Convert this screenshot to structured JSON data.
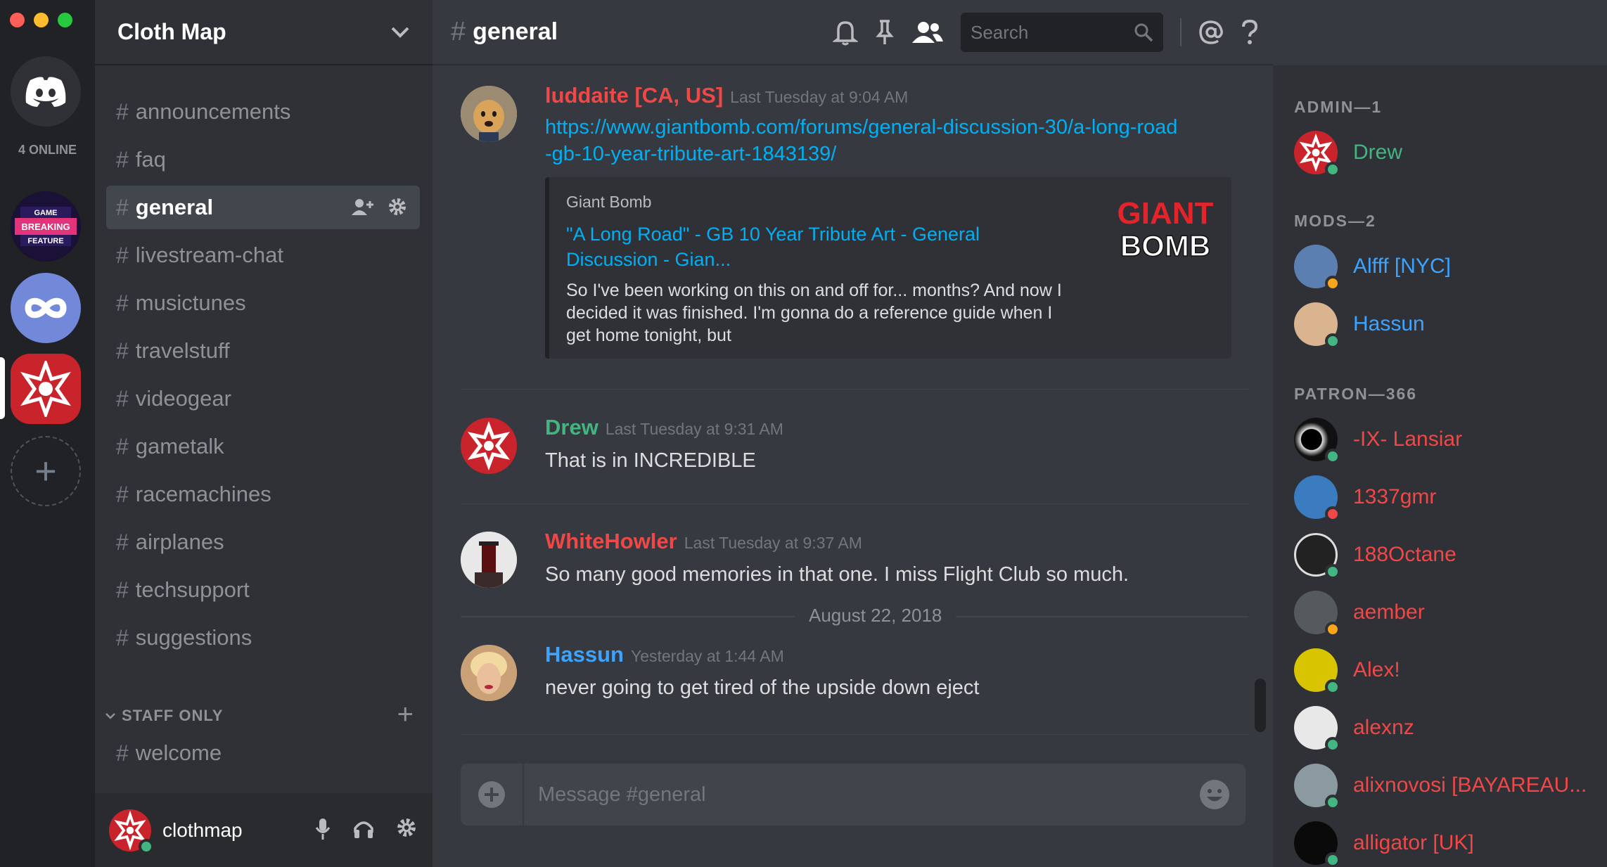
{
  "servers": {
    "online_label": "4 ONLINE",
    "game_badge": "GAME BREAKING FEATURE"
  },
  "guild": {
    "name": "Cloth Map"
  },
  "channels": [
    {
      "name": "announcements",
      "active": false
    },
    {
      "name": "faq",
      "active": false
    },
    {
      "name": "general",
      "active": true
    },
    {
      "name": "livestream-chat",
      "active": false
    },
    {
      "name": "musictunes",
      "active": false
    },
    {
      "name": "travelstuff",
      "active": false
    },
    {
      "name": "videogear",
      "active": false
    },
    {
      "name": "gametalk",
      "active": false
    },
    {
      "name": "racemachines",
      "active": false
    },
    {
      "name": "airplanes",
      "active": false
    },
    {
      "name": "techsupport",
      "active": false
    },
    {
      "name": "suggestions",
      "active": false
    }
  ],
  "staff": {
    "category": "STAFF ONLY",
    "channel": "welcome"
  },
  "user": {
    "name": "clothmap"
  },
  "chat": {
    "channel": "general",
    "search_placeholder": "Search",
    "composer_placeholder": "Message #general",
    "date_divider": "August 22, 2018",
    "messages": [
      {
        "author": "luddaite [CA, US]",
        "author_color": "#f04747",
        "timestamp": "Last Tuesday at 9:04 AM",
        "link": "https://www.giantbomb.com/forums/general-discussion-30/a-long-road-gb-10-year-tribute-art-1843139/",
        "embed": {
          "provider": "Giant Bomb",
          "title": "\"A Long Road\" - GB 10 Year Tribute Art - General Discussion - Gian...",
          "description": "So I've been working on this on and off for... months? And now I decided it was finished. I'm gonna do a reference guide when I get home tonight, but",
          "thumb_text_1": "GIANT",
          "thumb_text_2": "BOMB"
        }
      },
      {
        "author": "Drew",
        "author_color": "#43b581",
        "timestamp": "Last Tuesday at 9:31 AM",
        "text": "That is in INCREDIBLE"
      },
      {
        "author": "WhiteHowler",
        "author_color": "#f04747",
        "timestamp": "Last Tuesday at 9:37 AM",
        "text": "So many good memories in that one.  I miss Flight Club so much."
      },
      {
        "author": "Hassun",
        "author_color": "#3ca4ff",
        "timestamp": "Yesterday at 1:44 AM",
        "text": "never going to get tired of the upside down eject"
      }
    ]
  },
  "members": {
    "roles": [
      {
        "label": "ADMIN—1"
      },
      {
        "label": "MODS—2"
      },
      {
        "label": "PATRON—366"
      }
    ],
    "list": [
      {
        "name": "Drew",
        "color": "#43b581",
        "status": "#43b581",
        "avatar": "#c9232b"
      },
      {
        "name": "Alfff [NYC]",
        "color": "#3ca4ff",
        "status": "#faa61a",
        "avatar": "#5b7fb0"
      },
      {
        "name": "Hassun",
        "color": "#3ca4ff",
        "status": "#43b581",
        "avatar": "#d9b48f"
      },
      {
        "name": "-IX- Lansiar",
        "color": "#f04747",
        "status": "#43b581",
        "avatar": "#111111"
      },
      {
        "name": "1337gmr",
        "color": "#f04747",
        "status": "#f04747",
        "avatar": "#3b7bbf"
      },
      {
        "name": "188Octane",
        "color": "#f04747",
        "status": "#43b581",
        "avatar": "#222222"
      },
      {
        "name": "aember",
        "color": "#f04747",
        "status": "#faa61a",
        "avatar": "#555a5f"
      },
      {
        "name": "Alex!",
        "color": "#f04747",
        "status": "#43b581",
        "avatar": "#d8c400"
      },
      {
        "name": "alexnz",
        "color": "#f04747",
        "status": "#43b581",
        "avatar": "#e8e8e8"
      },
      {
        "name": "alixnovosi [BAYAREAU...",
        "color": "#f04747",
        "status": "#43b581",
        "avatar": "#8a9aa0"
      },
      {
        "name": "alligator [UK]",
        "color": "#f04747",
        "status": "#43b581",
        "avatar": "#0a0a0a"
      }
    ]
  }
}
